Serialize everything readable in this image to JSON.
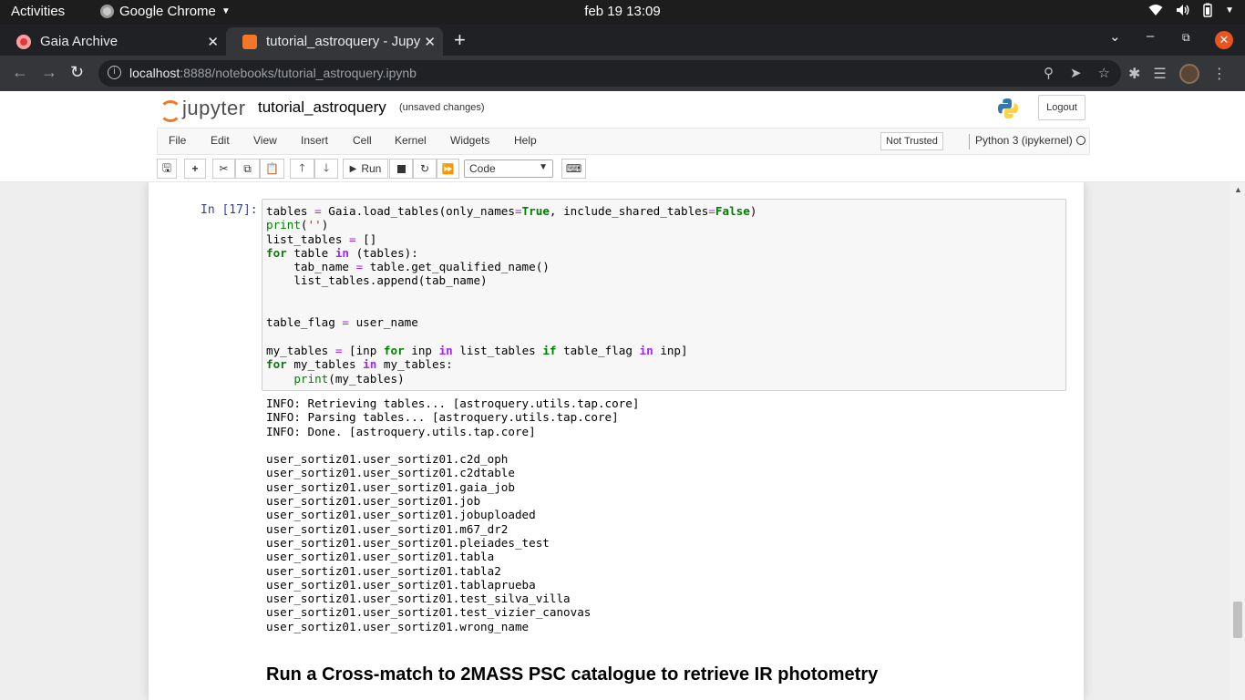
{
  "system_bar": {
    "activities": "Activities",
    "app_name": "Google Chrome",
    "datetime": "feb 19  13:09"
  },
  "browser": {
    "tabs": [
      {
        "title": "Gaia Archive",
        "active": false
      },
      {
        "title": "tutorial_astroquery - Jupy",
        "active": true
      }
    ],
    "url_host": "localhost",
    "url_rest": ":8888/notebooks/tutorial_astroquery.ipynb"
  },
  "jupyter": {
    "logo_text": "jupyter",
    "notebook_name": "tutorial_astroquery",
    "save_status": "(unsaved changes)",
    "logout_label": "Logout",
    "menu": [
      "File",
      "Edit",
      "View",
      "Insert",
      "Cell",
      "Kernel",
      "Widgets",
      "Help"
    ],
    "trust_label": "Not Trusted",
    "kernel_name": "Python 3 (ipykernel)",
    "run_label": "Run",
    "cell_type": "Code"
  },
  "cell": {
    "prompt": "In [17]:",
    "output_lines": [
      "INFO: Retrieving tables... [astroquery.utils.tap.core]",
      "INFO: Parsing tables... [astroquery.utils.tap.core]",
      "INFO: Done. [astroquery.utils.tap.core]",
      "",
      "user_sortiz01.user_sortiz01.c2d_oph",
      "user_sortiz01.user_sortiz01.c2dtable",
      "user_sortiz01.user_sortiz01.gaia_job",
      "user_sortiz01.user_sortiz01.job",
      "user_sortiz01.user_sortiz01.jobuploaded",
      "user_sortiz01.user_sortiz01.m67_dr2",
      "user_sortiz01.user_sortiz01.pleiades_test",
      "user_sortiz01.user_sortiz01.tabla",
      "user_sortiz01.user_sortiz01.tabla2",
      "user_sortiz01.user_sortiz01.tablaprueba",
      "user_sortiz01.user_sortiz01.test_silva_villa",
      "user_sortiz01.user_sortiz01.test_vizier_canovas",
      "user_sortiz01.user_sortiz01.wrong_name"
    ]
  },
  "markdown_heading": "Run a Cross-match to 2MASS PSC catalogue to retrieve IR photometry"
}
